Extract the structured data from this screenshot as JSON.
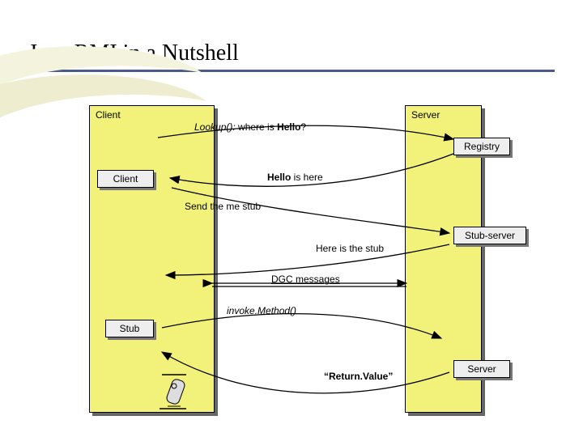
{
  "title": "Java RMI in a Nutshell",
  "panels": {
    "client": "Client",
    "server": "Server"
  },
  "boxes": {
    "client_inner": "Client",
    "registry": "Registry",
    "stub_server": "Stub-server",
    "stub": "Stub",
    "server_inner": "Server"
  },
  "labels": {
    "lookup_prefix": "Lookup(): ",
    "lookup_mid": "where is ",
    "lookup_bold": "Hello",
    "lookup_suffix": "?",
    "hello_bold": "Hello",
    "hello_rest": " is here",
    "send_stub": "Send the me stub",
    "here_stub": "Here is the stub",
    "dgc": "DGC messages",
    "invoke": "invoke.Method()",
    "return": "“Return.Value”"
  }
}
